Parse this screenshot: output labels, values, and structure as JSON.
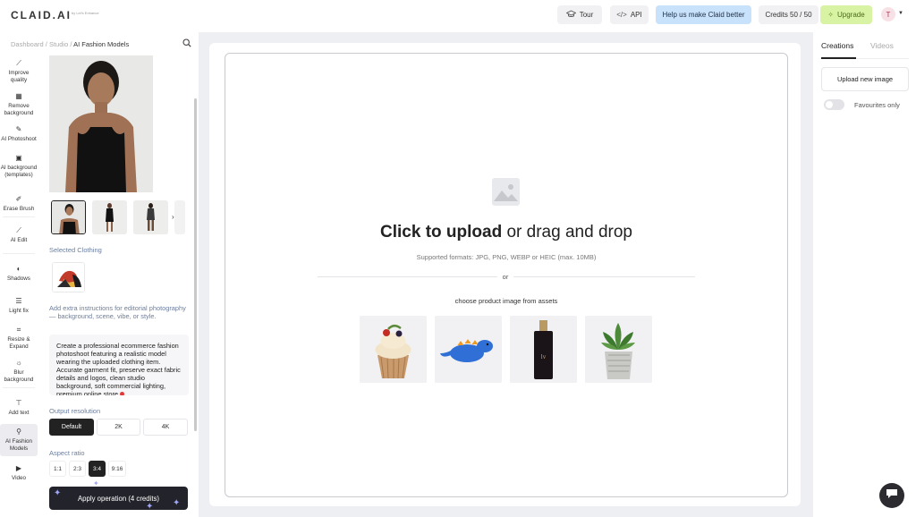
{
  "header": {
    "logo": "CLAID.AI",
    "logo_sub": "by Let's Enhance",
    "tour_label": "Tour",
    "api_label": "API",
    "help_label": "Help us make Claid better",
    "credits_label": "Credits 50 / 50",
    "upgrade_label": "Upgrade",
    "avatar_initial": "T"
  },
  "nav": {
    "items": [
      {
        "label": "Improve quality"
      },
      {
        "label": "Remove background"
      },
      {
        "label": "AI Photoshoot"
      },
      {
        "label": "AI background (templates)"
      },
      {
        "label": "Erase Brush"
      },
      {
        "label": "AI Edit"
      },
      {
        "label": "Shadows"
      },
      {
        "label": "Light fix"
      },
      {
        "label": "Resize & Expand"
      },
      {
        "label": "Blur background"
      },
      {
        "label": "Add text"
      },
      {
        "label": "AI Fashion Models"
      },
      {
        "label": "Video"
      }
    ]
  },
  "panel": {
    "breadcrumb": {
      "root": "Dashboard",
      "sep1": " / ",
      "mid": "Studio",
      "sep2": " / ",
      "current": "AI Fashion Models"
    },
    "selected_clothing_label": "Selected Clothing",
    "extra_hint": "Add extra instructions for editorial photography — background, scene, vibe, or style.",
    "prompt_text": "Create a professional ecommerce fashion photoshoot featuring a realistic model wearing the uploaded clothing item. Accurate garment fit, preserve exact fabric details and logos, clean studio background, soft commercial lighting, premium online store",
    "output_resolution_label": "Output resolution",
    "resolutions": [
      "Default",
      "2K",
      "4K"
    ],
    "aspect_ratio_label": "Aspect ratio",
    "ratios": [
      "1:1",
      "2:3",
      "3:4",
      "9:16"
    ],
    "apply_label": "Apply operation (4 credits)"
  },
  "main": {
    "upload_bold": "Click to upload",
    "upload_rest": " or drag and drop",
    "formats": "Supported formats: JPG, PNG, WEBP or HEIC (max. 10MB)",
    "or_text": "or",
    "assets_label": "choose product image from assets"
  },
  "right": {
    "tab_creations": "Creations",
    "tab_videos": "Videos",
    "upload_new": "Upload new image",
    "favourites": "Favourites only"
  },
  "colors": {
    "accent_help": "#c8e2fb",
    "accent_upgrade": "#d7f3a3",
    "dark_button": "#23242b"
  }
}
